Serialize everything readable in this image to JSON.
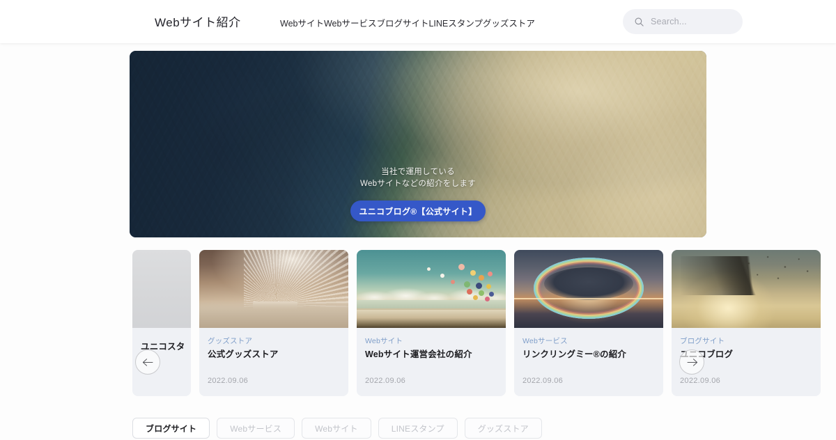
{
  "header": {
    "brand": "Webサイト紹介",
    "nav": [
      {
        "label": "Webサイト"
      },
      {
        "label": "Webサービス"
      },
      {
        "label": "ブログサイト"
      },
      {
        "label": "LINEスタンプ"
      },
      {
        "label": "グッズストア"
      }
    ],
    "search": {
      "icon": "search-icon",
      "placeholder": "Search...",
      "value": ""
    }
  },
  "hero": {
    "line1": "当社で運用している",
    "line2": "Webサイトなどの紹介をします",
    "button_label": "ユニコブログ®【公式サイト】",
    "button_color": "#3558c8"
  },
  "carousel": {
    "prev_icon": "arrow-left-icon",
    "next_icon": "arrow-right-icon",
    "cards": [
      {
        "category": "",
        "title": "ユニコスタ",
        "date": "",
        "thumb": "placeholder-gray",
        "partial": true
      },
      {
        "category": "グッズストア",
        "title": "公式グッズストア",
        "date": "2022.09.06",
        "thumb": "goods-pampas",
        "partial": false
      },
      {
        "category": "Webサイト",
        "title": "Webサイト運営会社の紹介",
        "date": "2022.09.06",
        "thumb": "balloons-beach",
        "partial": false
      },
      {
        "category": "Webサービス",
        "title": "リンクリングミー®の紹介",
        "date": "2022.09.06",
        "thumb": "rainbow-sunset",
        "partial": false
      },
      {
        "category": "ブログサイト",
        "title": "ユニコブログ",
        "date": "2022.09.06",
        "thumb": "branch-sunset",
        "partial": false
      }
    ],
    "category_color": "#7f9ec9"
  },
  "filters": [
    {
      "label": "ブログサイト",
      "active": true
    },
    {
      "label": "Webサービス",
      "active": false
    },
    {
      "label": "Webサイト",
      "active": false
    },
    {
      "label": "LINEスタンプ",
      "active": false
    },
    {
      "label": "グッズストア",
      "active": false
    }
  ]
}
